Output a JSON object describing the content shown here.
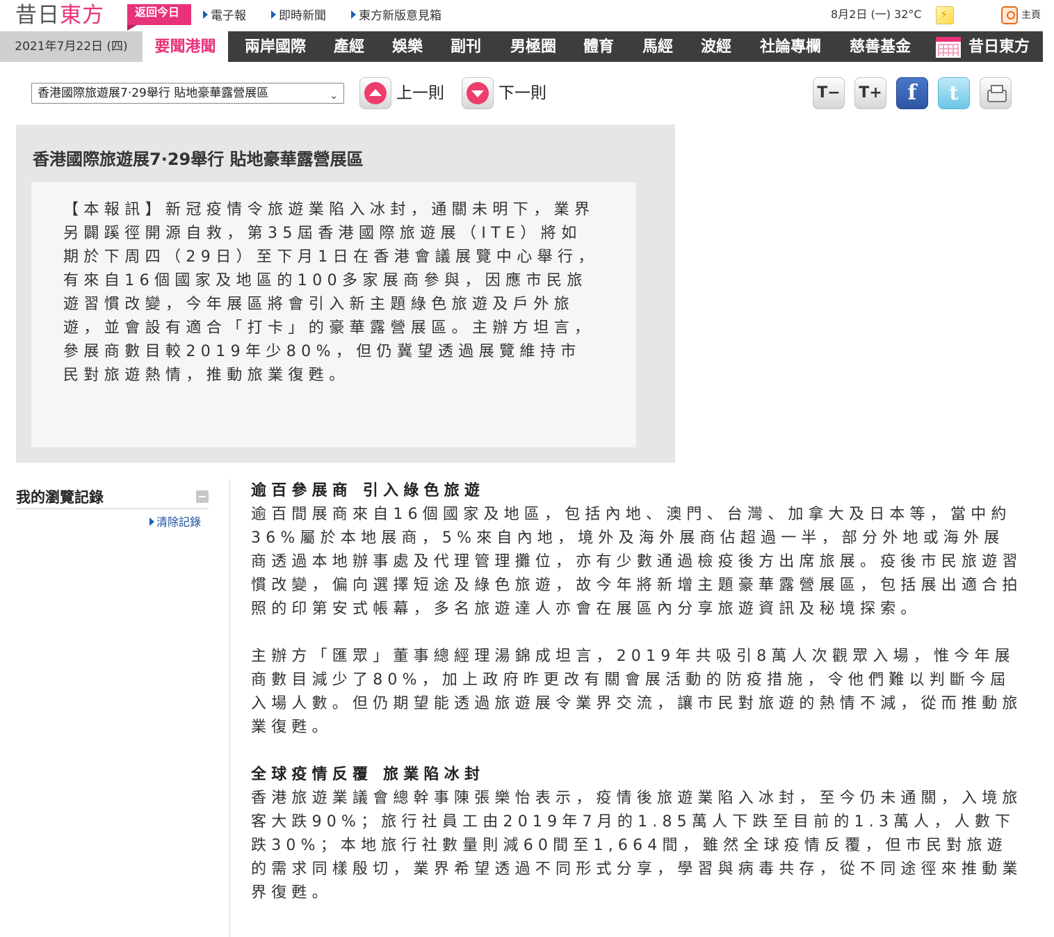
{
  "header": {
    "logo_part1": "昔日",
    "logo_part2": "東方",
    "return_today": "返回今日",
    "links": [
      "電子報",
      "即時新聞",
      "東方新版意見箱"
    ],
    "weather": "8月2日 (一) 32°C",
    "home": "主頁"
  },
  "nav": {
    "date": "2021年7月22日 (四)",
    "items": [
      "要聞港聞",
      "兩岸國際",
      "產經",
      "娛樂",
      "副刊",
      "男極圈",
      "體育",
      "馬經",
      "波經",
      "社論專欄",
      "慈善基金",
      "昔日東方"
    ]
  },
  "toolbar": {
    "selected_article": "香港國際旅遊展7·29舉行 貼地豪華露營展區",
    "prev_label": "上一則",
    "next_label": "下一則",
    "text_smaller": "T−",
    "text_larger": "T+",
    "facebook": "f",
    "twitter": "t"
  },
  "summary": {
    "title": "香港國際旅遊展7·29舉行 貼地豪華露營展區",
    "text": "【本報訊】新冠疫情令旅遊業陷入冰封，通關未明下，業界另闢蹊徑開源自救，第35屆香港國際旅遊展（ITE）將如期於下周四（29日）至下月1日在香港會議展覽中心舉行，有來自16個國家及地區的100多家展商參與，因應市民旅遊習慣改變，今年展區將會引入新主題綠色旅遊及戶外旅遊，並會設有適合「打卡」的豪華露營展區。主辦方坦言，參展商數目較2019年少80%，但仍冀望透過展覽維持市民對旅遊熱情，推動旅業復甦。"
  },
  "sidebar": {
    "title": "我的瀏覽記錄",
    "clear": "清除記錄"
  },
  "article": {
    "sub1": "逾百參展商 引入綠色旅遊",
    "para1": "逾百間展商來自16個國家及地區，包括內地、澳門、台灣、加拿大及日本等，當中約36%屬於本地展商，5%來自內地，境外及海外展商佔超過一半，部分外地或海外展商透過本地辦事處及代理管理攤位，亦有少數通過檢疫後方出席旅展。疫後市民旅遊習慣改變，偏向選擇短途及綠色旅遊，故今年將新增主題豪華露營展區，包括展出適合拍照的印第安式帳幕，多名旅遊達人亦會在展區內分享旅遊資訊及秘境探索。",
    "para2": "主辦方「匯眾」董事總經理湯錦成坦言，2019年共吸引8萬人次觀眾入場，惟今年展商數目減少了80%，加上政府昨更改有關會展活動的防疫措施，令他們難以判斷今屆入場人數。但仍期望能透過旅遊展令業界交流，讓市民對旅遊的熱情不減，從而推動旅業復甦。",
    "sub2": "全球疫情反覆 旅業陷冰封",
    "para3": "香港旅遊業議會總幹事陳張樂怡表示，疫情後旅遊業陷入冰封，至今仍未通關，入境旅客大跌90%；旅行社員工由2019年7月的1.85萬人下跌至目前的1.3萬人，人數下跌30%；本地旅行社數量則減60間至1,664間，雖然全球疫情反覆，但市民對旅遊的需求同樣殷切，業界希望透過不同形式分享，學習與病毒共存，從不同途徑來推動業界復甦。"
  },
  "colors": {
    "brand_pink": "#e8327a",
    "nav_dark": "#3d3d3d",
    "link_blue": "#1a4f9c"
  },
  "icons": [
    "return-today-badge",
    "weather-icon",
    "home-icon",
    "calendar-icon",
    "up-arrow-icon",
    "down-arrow-icon",
    "text-smaller-icon",
    "text-larger-icon",
    "facebook-icon",
    "twitter-icon",
    "print-icon",
    "collapse-icon"
  ]
}
